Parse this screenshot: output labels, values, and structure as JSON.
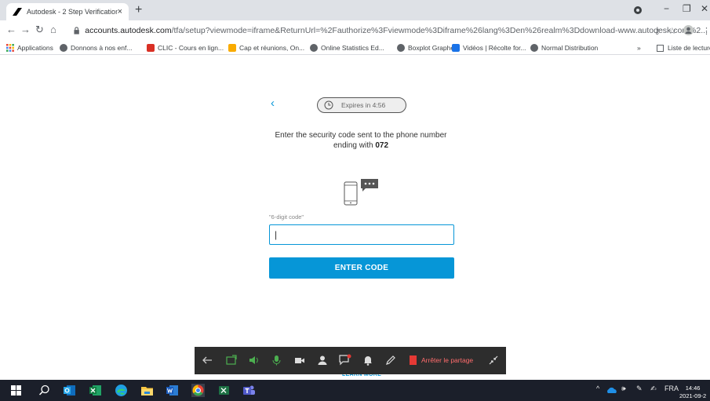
{
  "browser": {
    "tab_title": "Autodesk - 2 Step Verification",
    "tab_close": "×",
    "new_tab": "+",
    "url_host": "accounts.autodesk.com",
    "url_path": "/tfa/setup?viewmode=iframe&ReturnUrl=%2Fauthorize%3Fviewmode%3Diframe%26lang%3Den%26realm%3Ddownload-www.autodesk.com%2..."
  },
  "bookmarks": {
    "items": [
      {
        "label": "Applications",
        "color": "#e37400"
      },
      {
        "label": "Donnons à nos enf...",
        "color": "#5f6368"
      },
      {
        "label": "CLIC - Cours en lign...",
        "color": "#d93025"
      },
      {
        "label": "Cap et réunions, On...",
        "color": "#f9ab00"
      },
      {
        "label": "Online Statistics Ed...",
        "color": "#5f6368"
      },
      {
        "label": "Boxplot Grapher",
        "color": "#5f6368"
      },
      {
        "label": "Vidéos | Récolte for...",
        "color": "#1a73e8"
      },
      {
        "label": "Normal Distribution",
        "color": "#5f6368"
      }
    ],
    "overflow": "»",
    "reading_list": "Liste de lecture"
  },
  "verification": {
    "expires_text": "Expires in 4:56",
    "prompt_line1": "Enter the security code sent to the phone number",
    "prompt_line2_prefix": "ending with ",
    "phone_suffix": "072",
    "field_label": "\"6-digit code\"",
    "code_value": "|",
    "submit_label": "ENTER CODE",
    "learn_more": "LEARN MORE"
  },
  "sharing": {
    "stop_label": "Arrêter le partage"
  },
  "taskbar": {
    "language": "FRA",
    "time": "14:46",
    "date": "2021-09-2"
  },
  "colors": {
    "accent": "#0696d7",
    "stop_red": "#e53935"
  }
}
